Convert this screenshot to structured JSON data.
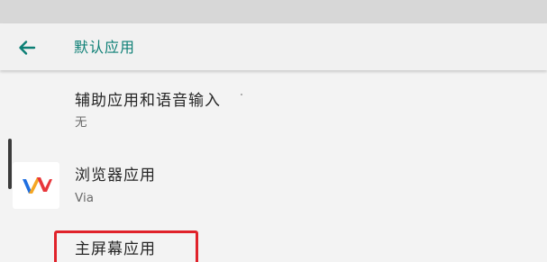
{
  "header": {
    "title": "默认应用",
    "back_icon": "arrow-left-icon",
    "accent_color": "#0c7f75"
  },
  "items": [
    {
      "title": "辅助应用和语音输入",
      "subtitle": "无"
    },
    {
      "title": "浏览器应用",
      "subtitle": "Via",
      "icon": "via-browser-icon"
    },
    {
      "title": "主屏幕应用",
      "subtitle": ""
    }
  ],
  "colors": {
    "highlight_border": "#e0222a",
    "status_bar": "#d7d7d7",
    "background": "#f3f3f3"
  }
}
